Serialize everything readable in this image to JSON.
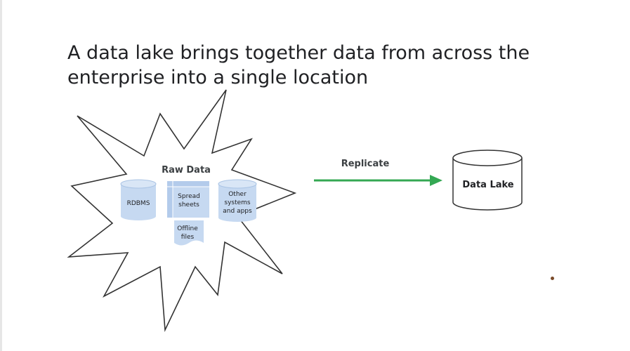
{
  "slide": {
    "title_line1": "A data lake brings together data from across the",
    "title_line2": "enterprise into a single location"
  },
  "raw_data": {
    "title": "Raw Data",
    "sources": [
      {
        "label_lines": [
          "RDBMS"
        ],
        "icon": "database-cylinder-icon"
      },
      {
        "label_lines": [
          "Spread",
          "sheets"
        ],
        "icon": "spreadsheet-icon"
      },
      {
        "label_lines": [
          "Other",
          "systems",
          "and apps"
        ],
        "icon": "database-cylinder-icon"
      },
      {
        "label_lines": [
          "Offline",
          "files"
        ],
        "icon": "document-icon"
      }
    ]
  },
  "arrow": {
    "label": "Replicate",
    "color": "#34a853"
  },
  "data_lake": {
    "label": "Data Lake",
    "icon": "database-cylinder-icon"
  },
  "colors": {
    "source_fill": "#c6d9f1",
    "source_stroke": "#a9c3e4",
    "outline": "#333333"
  }
}
